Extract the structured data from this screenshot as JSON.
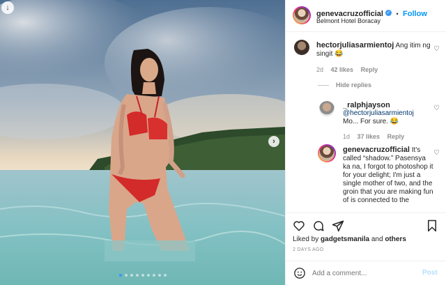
{
  "post": {
    "username": "genevacruzofficial",
    "follow_label": "Follow",
    "separator": "•",
    "location": "Belmont Hotel Boracay",
    "photo_dots": 9,
    "active_dot": 0
  },
  "comments": [
    {
      "username": "hectorjuliasarmientoj",
      "text": "Ang itim ng singit 😂",
      "time": "2d",
      "likes": "42 likes",
      "reply_label": "Reply",
      "hide_replies": "Hide replies"
    },
    {
      "username": "_ralphjayson",
      "mention": "@hectorjuliasarmientoj",
      "text": "Mo... For sure. 😂",
      "time": "1d",
      "likes": "37 likes",
      "reply_label": "Reply"
    },
    {
      "username": "genevacruzofficial",
      "text": "It's called “shadow.” Pasensya ka na, I forgot to photoshop it for your delight; I'm just a single mother of two, and the groin that you are making fun of is connected to the"
    }
  ],
  "footer": {
    "liked_prefix": "Liked by",
    "liked_user": "gadgetsmanila",
    "liked_and": "and",
    "liked_others": "others",
    "timestamp": "2 DAYS AGO",
    "add_comment_placeholder": "Add a comment...",
    "post_label": "Post"
  },
  "icons": {
    "heart": "heart-icon",
    "comment": "comment-icon",
    "share": "share-icon",
    "save": "bookmark-icon",
    "emoji": "emoji-icon"
  },
  "colors": {
    "accent": "#0095f6",
    "verified": "#3897f0",
    "post_disabled": "#b2dffc"
  }
}
